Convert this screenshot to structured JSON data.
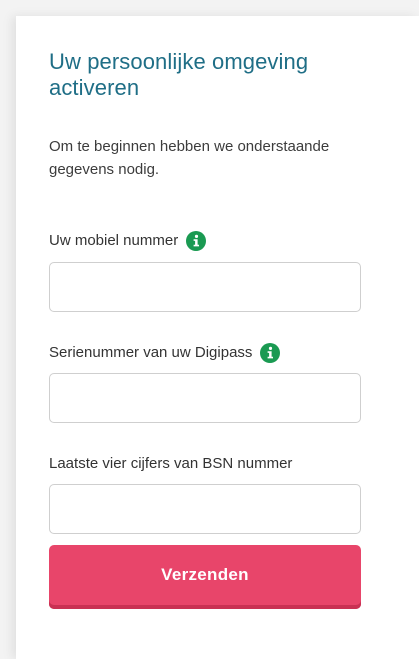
{
  "form": {
    "title": "Uw persoonlijke omgeving activeren",
    "intro": "Om te beginnen hebben we onderstaande gegevens nodig.",
    "fields": [
      {
        "label": "Uw mobiel nummer",
        "value": "",
        "has_info_icon": true,
        "icon": "info-icon"
      },
      {
        "label": "Serienummer van uw Digipass",
        "value": "",
        "has_info_icon": true,
        "icon": "info-icon"
      },
      {
        "label": "Laatste vier cijfers van BSN nummer",
        "value": "",
        "has_info_icon": false
      }
    ],
    "submit_label": "Verzenden"
  },
  "colors": {
    "title": "#1f6e86",
    "info_icon": "#1a9a52",
    "button": "#e8456a",
    "button_shadow": "#c93153"
  }
}
